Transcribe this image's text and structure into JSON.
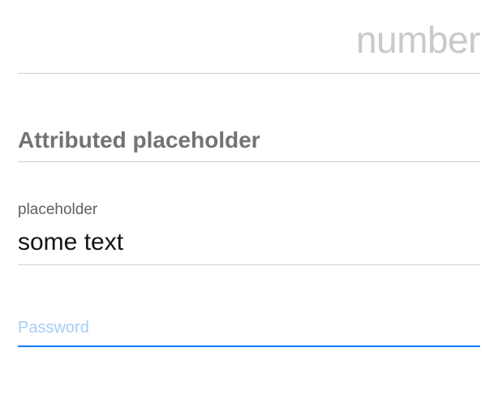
{
  "numberField": {
    "placeholder": "number",
    "value": ""
  },
  "attributedField": {
    "placeholder": "Attributed placeholder",
    "value": ""
  },
  "labeledField": {
    "label": "placeholder",
    "value": "some text"
  },
  "passwordField": {
    "placeholder": "Password",
    "value": ""
  }
}
